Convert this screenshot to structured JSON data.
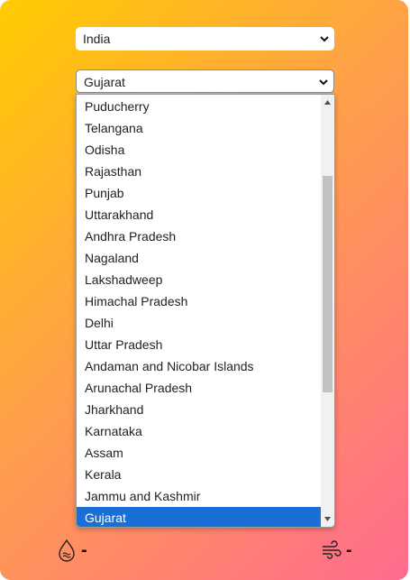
{
  "country_select": {
    "value": "India"
  },
  "state_select": {
    "value": "Gujarat",
    "options": [
      "Puducherry",
      "Telangana",
      "Odisha",
      "Rajasthan",
      "Punjab",
      "Uttarakhand",
      "Andhra Pradesh",
      "Nagaland",
      "Lakshadweep",
      "Himachal Pradesh",
      "Delhi",
      "Uttar Pradesh",
      "Andaman and Nicobar Islands",
      "Arunachal Pradesh",
      "Jharkhand",
      "Karnataka",
      "Assam",
      "Kerala",
      "Jammu and Kashmir",
      "Gujarat"
    ],
    "selected": "Gujarat"
  },
  "humidity": {
    "icon": "humidity-icon",
    "value": "-"
  },
  "wind": {
    "icon": "wind-icon",
    "value": "-"
  }
}
